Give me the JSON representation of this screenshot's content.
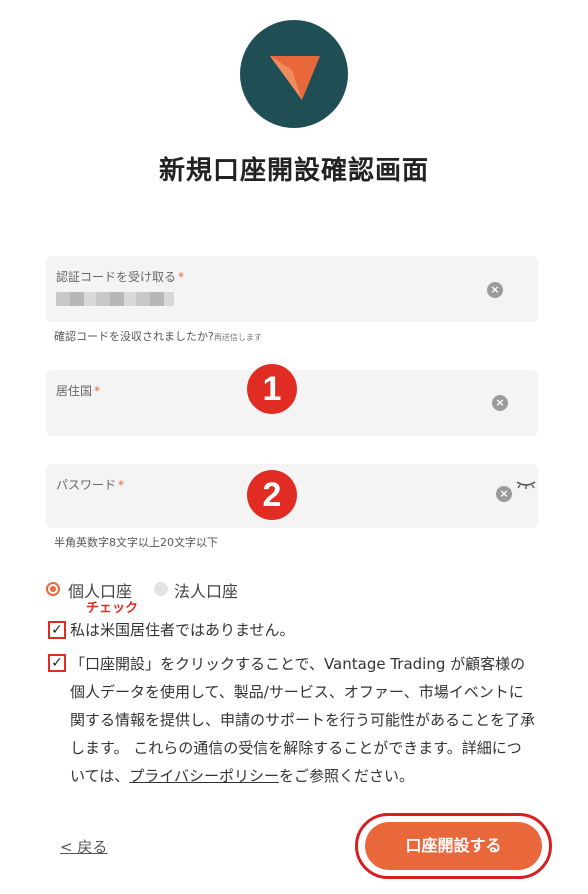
{
  "brand": {
    "logo_color": "#1f4e55",
    "accent": "#e8683b",
    "icon": "vantage-logo"
  },
  "page_title": "新規口座開設確認画面",
  "fields": {
    "verification": {
      "label": "認証コードを受け取る",
      "required_mark": "*",
      "helper": "確認コードを没収されましたか?",
      "helper_small": "再送信します"
    },
    "country": {
      "label": "居住国",
      "required_mark": "*"
    },
    "password": {
      "label": "パスワード",
      "required_mark": "*",
      "helper": "半角英数字8文字以上20文字以下"
    }
  },
  "annotations": {
    "badge1": "1",
    "badge2": "2",
    "check_note": "チェック"
  },
  "account_type": {
    "options": [
      "個人口座",
      "法人口座"
    ],
    "selected": "個人口座"
  },
  "consents": {
    "us_resident": "私は米国居住者ではありません。",
    "marketing_prefix": "「口座開設」をクリックすることで、Vantage Trading が顧客様の個人データを使用して、製品/サービス、オファー、市場イベントに関する情報を提供し、申請のサポートを行う可能性があることを了承します。 これらの通信の受信を解除することができます。詳細については、",
    "privacy_link": "プライバシーポリシー",
    "marketing_suffix": "をご参照ください。"
  },
  "actions": {
    "back": "< 戻る",
    "submit": "口座開設する"
  }
}
